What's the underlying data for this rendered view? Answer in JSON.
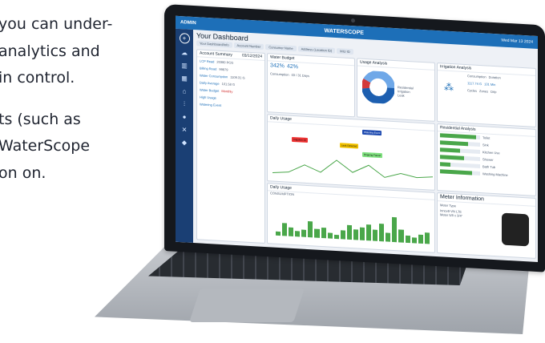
{
  "copy": {
    "lines": [
      "you can under-",
      "analytics and",
      "in control.",
      "",
      "ts (such as",
      "WaterScope",
      "on on."
    ]
  },
  "dashboard": {
    "topbar": {
      "admin": "ADMIN",
      "logo": "WATERSCOPE",
      "date": "Wed Mar 13 2024"
    },
    "title": "Your Dashboard",
    "tabs": [
      "Your Dashboard/Info",
      "Account Number",
      "Consumer Name",
      "Address (Location ID)",
      "MIU ID"
    ],
    "account_summary": {
      "header": "Account Summary",
      "date": "03/12/2024",
      "items": [
        {
          "label": "LCP Read",
          "value": "20380 PCG"
        },
        {
          "label": "Billing Read",
          "value": "99879"
        },
        {
          "label": "Water Consumption",
          "value": "1109.31 G"
        },
        {
          "label": "Daily Average",
          "value": "101.58 G"
        },
        {
          "label": "Water Budget",
          "value": "Monthly"
        },
        {
          "label": "High Usage",
          "value": ""
        },
        {
          "label": "Watering Event",
          "value": ""
        }
      ]
    },
    "water_budget": {
      "header": "Water Budget",
      "pct_a": "342%",
      "pct_b": "42%",
      "consumption_label": "Consumption",
      "days": "03 / 31 Days"
    },
    "usage_analysis": {
      "header": "Usage Analysis",
      "legend": [
        "Residential",
        "Irrigation",
        "Leak"
      ],
      "colors": [
        "#1d5fb0",
        "#6fa8e8",
        "#d43a3a"
      ]
    },
    "irrigation_analysis": {
      "header": "Irrigation Analysis",
      "consumption": "1117.74 G",
      "duration": "131 Min",
      "labels": [
        "Consumption",
        "Duration",
        "Cycles",
        "Zones",
        "Drip"
      ],
      "values": [
        "1",
        "7",
        "0/0"
      ]
    },
    "daily_usage_top": {
      "header": "Daily Usage",
      "callouts": [
        "Irrigation 10",
        "Leak Detected",
        "Watering Event",
        "Dripping Faucet"
      ]
    },
    "daily_usage_bottom": {
      "header": "Daily Usage",
      "ylabel": "CONSUMPTION",
      "bars": [
        0.15,
        0.45,
        0.3,
        0.2,
        0.25,
        0.55,
        0.3,
        0.35,
        0.2,
        0.15,
        0.3,
        0.5,
        0.35,
        0.45,
        0.55,
        0.4,
        0.6,
        0.3,
        0.85,
        0.45,
        0.25,
        0.2,
        0.3,
        0.4
      ]
    },
    "residential_analysis": {
      "header": "Residential Analysis",
      "items": [
        {
          "label": "Toilet",
          "value": 0.9
        },
        {
          "label": "Sink",
          "value": 0.7
        },
        {
          "label": "Kitchen Use",
          "value": 0.5
        },
        {
          "label": "Shower",
          "value": 0.6
        },
        {
          "label": "Bath Tub",
          "value": 0.25
        },
        {
          "label": "Washing Machine",
          "value": 0.8
        }
      ]
    },
    "meter_info": {
      "header": "Meter Information",
      "type_label": "Meter Type",
      "model": "Innov8-VN LTE",
      "size": "Meter 5/8 x 3/4\""
    }
  }
}
